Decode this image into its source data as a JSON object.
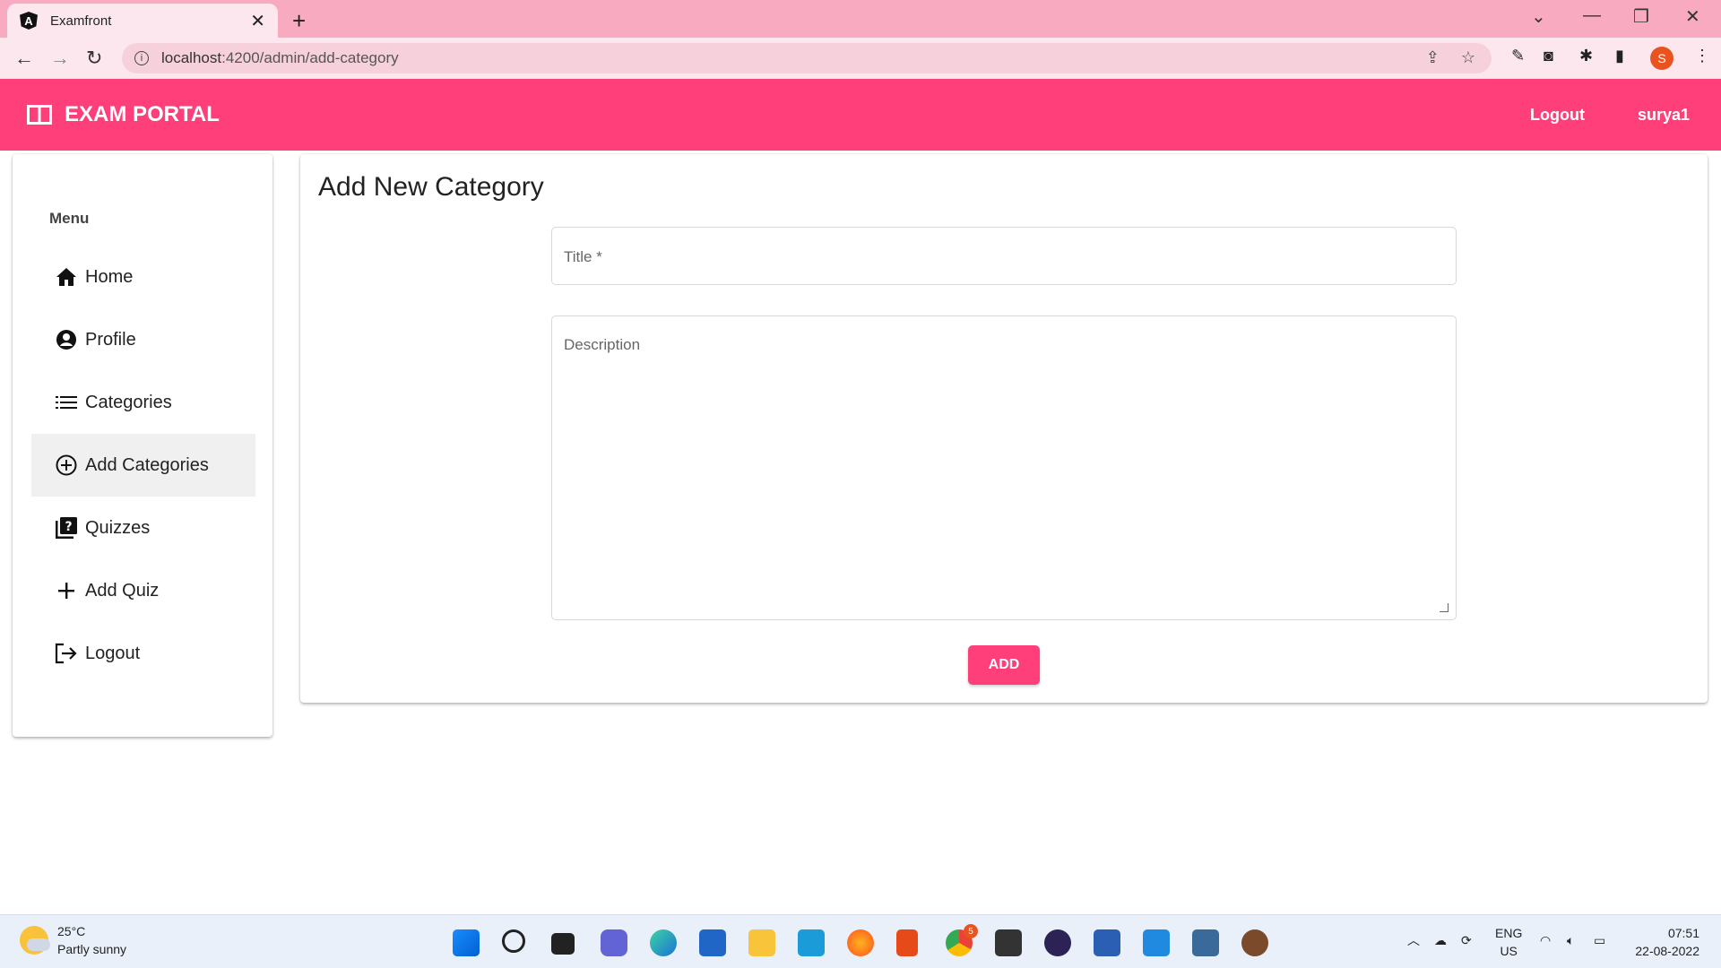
{
  "browser": {
    "tab_title": "Examfront",
    "url_host": "localhost",
    "url_rest": ":4200/admin/add-category",
    "profile_initial": "S"
  },
  "app": {
    "brand": "EXAM PORTAL",
    "nav_logout": "Logout",
    "nav_user": "surya1",
    "accent_color": "#ff3f7a"
  },
  "sidebar": {
    "header": "Menu",
    "items": [
      {
        "label": "Home",
        "icon": "home-icon"
      },
      {
        "label": "Profile",
        "icon": "account-circle-icon"
      },
      {
        "label": "Categories",
        "icon": "list-icon"
      },
      {
        "label": "Add Categories",
        "icon": "add-circle-icon",
        "active": true
      },
      {
        "label": "Quizzes",
        "icon": "quiz-icon"
      },
      {
        "label": "Add Quiz",
        "icon": "plus-icon"
      },
      {
        "label": "Logout",
        "icon": "logout-icon"
      }
    ]
  },
  "form": {
    "title": "Add New Category",
    "title_label": "Title *",
    "description_label": "Description",
    "submit_label": "ADD"
  },
  "taskbar": {
    "temperature": "25°C",
    "weather": "Partly sunny",
    "lang_top": "ENG",
    "lang_bottom": "US",
    "time": "07:51",
    "date": "22-08-2022",
    "chrome_badge": "5"
  }
}
